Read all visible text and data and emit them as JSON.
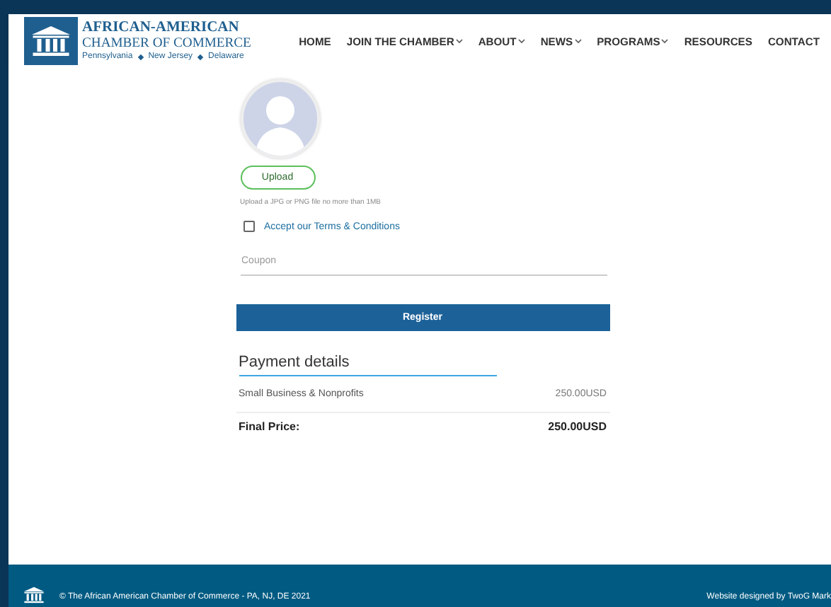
{
  "logo": {
    "title": "AFRICAN-AMERICAN",
    "subtitle": "CHAMBER OF COMMERCE",
    "states": [
      "Pennsylvania",
      "New Jersey",
      "Delaware"
    ]
  },
  "nav": [
    {
      "label": "HOME",
      "has_dropdown": false
    },
    {
      "label": "JOIN THE CHAMBER",
      "has_dropdown": true
    },
    {
      "label": "ABOUT",
      "has_dropdown": true
    },
    {
      "label": "NEWS",
      "has_dropdown": true
    },
    {
      "label": "PROGRAMS",
      "has_dropdown": true
    },
    {
      "label": "RESOURCES",
      "has_dropdown": false
    },
    {
      "label": "CONTACT",
      "has_dropdown": false
    }
  ],
  "form": {
    "upload_button": "Upload",
    "upload_hint": "Upload a JPG or PNG file no more than 1MB",
    "terms": {
      "label": "Accept our Terms & Conditions",
      "checked": false
    },
    "coupon": {
      "placeholder": "Coupon"
    },
    "register_button": "Register"
  },
  "payment": {
    "title": "Payment details",
    "items": [
      {
        "name": "Small Business & Nonprofits",
        "price": "250.00USD"
      }
    ],
    "total_label": "Final Price:",
    "total": "250.00USD"
  },
  "footer": {
    "copyright": "© The African American Chamber of Commerce - PA, NJ, DE 2021",
    "credit": "Website designed by TwoG Mark"
  }
}
